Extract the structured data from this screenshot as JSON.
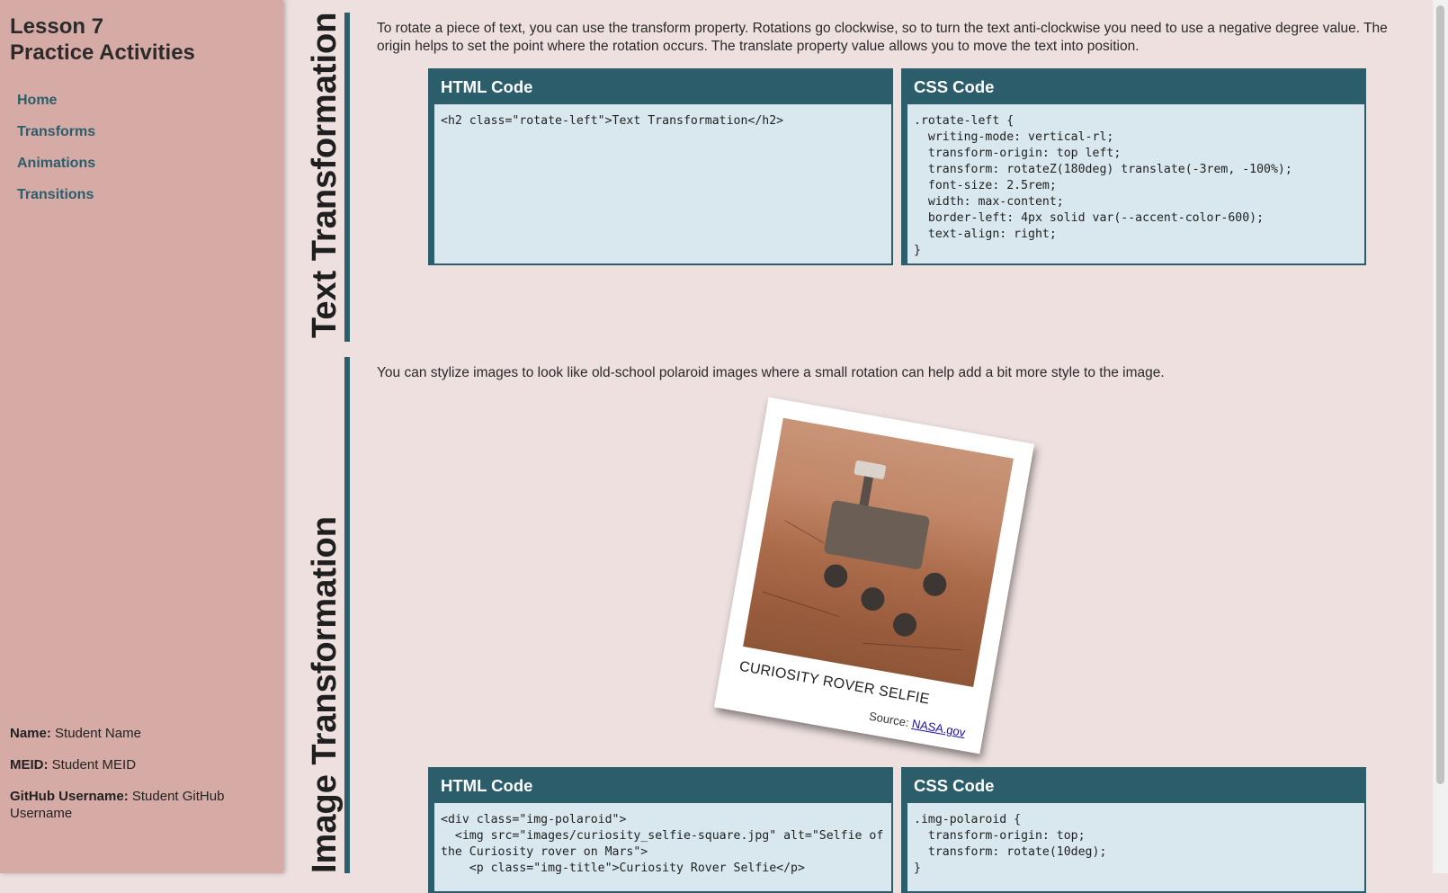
{
  "sidebar": {
    "title_line1": "Lesson 7",
    "title_line2": "Practice Activities",
    "nav": [
      {
        "label": "Home"
      },
      {
        "label": "Transforms"
      },
      {
        "label": "Animations"
      },
      {
        "label": "Transitions"
      }
    ],
    "student": {
      "name_label": "Name:",
      "name_value": "Student Name",
      "meid_label": "MEID:",
      "meid_value": "Student MEID",
      "github_label": "GitHub Username:",
      "github_value": "Student GitHub Username"
    }
  },
  "sections": [
    {
      "heading": "Text Transformation",
      "paragraph": "To rotate a piece of text, you can use the transform property. Rotations go clockwise, so to turn the text anti-clockwise you need to use a negative degree value. The origin helps to set the point where the rotation occurs. The translate property value allows you to move the text into position.",
      "html_title": "HTML Code",
      "html_code": "<h2 class=\"rotate-left\">Text Transformation</h2>",
      "css_title": "CSS Code",
      "css_code": ".rotate-left {\n  writing-mode: vertical-rl;\n  transform-origin: top left;\n  transform: rotateZ(180deg) translate(-3rem, -100%);\n  font-size: 2.5rem;\n  width: max-content;\n  border-left: 4px solid var(--accent-color-600);\n  text-align: right;\n}"
    },
    {
      "heading": "Image Transformation",
      "paragraph": "You can stylize images to look like old-school polaroid images where a small rotation can help add a bit more style to the image.",
      "polaroid": {
        "caption": "Curiosity Rover Selfie",
        "source_label": "Source:",
        "source_link": "NASA.gov"
      },
      "html_title": "HTML Code",
      "html_code": "<div class=\"img-polaroid\">\n  <img src=\"images/curiosity_selfie-square.jpg\" alt=\"Selfie of the Curiosity rover on Mars\">\n    <p class=\"img-title\">Curiosity Rover Selfie</p>",
      "css_title": "CSS Code",
      "css_code": ".img-polaroid {\n  transform-origin: top;\n  transform: rotate(10deg);\n}"
    }
  ],
  "colors": {
    "sidebar_bg": "#d6aba6",
    "page_bg": "#ede0df",
    "accent": "#2b5d6b",
    "code_bg": "#d8e8ee"
  }
}
